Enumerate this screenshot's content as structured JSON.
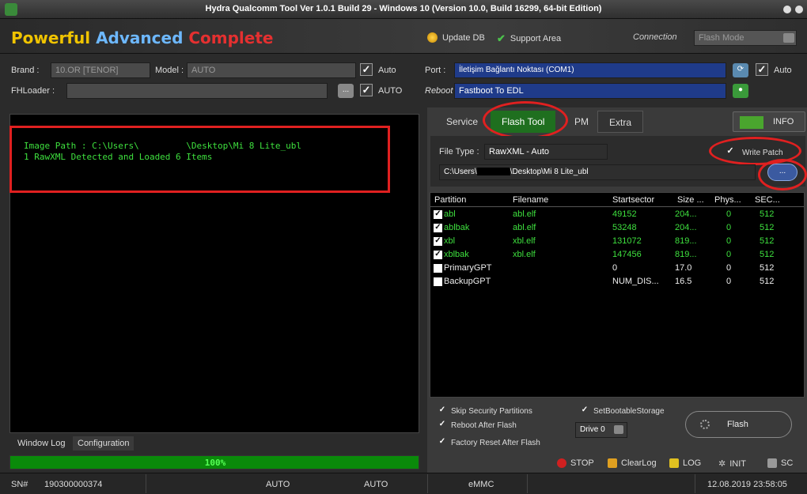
{
  "window": {
    "title": "Hydra Qualcomm Tool Ver 1.0.1 Build 29 -  Windows 10 (Version 10.0, Build 16299, 64-bit Edition)"
  },
  "header": {
    "brand": [
      "Powerful",
      "Advanced",
      "Complete"
    ],
    "update_db": "Update DB",
    "support_area": "Support Area",
    "connection_label": "Connection",
    "connection_mode": "Flash Mode"
  },
  "left_config": {
    "brand_label": "Brand :",
    "brand_value": "10.OR [TENOR]",
    "model_label": "Model :",
    "model_value": "AUTO",
    "auto1": "Auto",
    "fhloader_label": "FHLoader :",
    "fhloader_value": "",
    "fh_btn": "...",
    "auto2": "AUTO"
  },
  "right_config": {
    "port_label": "Port :",
    "port_value": "İletişim Bağlantı Noktası (COM1)",
    "port_auto": "Auto",
    "reboot_label": "Reboot",
    "reboot_value": "Fastboot To EDL"
  },
  "log": {
    "line1": "Image Path : C:\\Users\\         \\Desktop\\Mi 8 Lite_ubl",
    "line2": "1 RawXML Detected and Loaded 6 Items"
  },
  "bottom_tabs": [
    "Window Log",
    "Configuration"
  ],
  "progress": {
    "value": 1.0,
    "label": "100%"
  },
  "tabs": [
    "Service",
    "Flash Tool",
    "PM",
    "Extra"
  ],
  "info_label": "INFO",
  "filetype": {
    "label": "File Type :",
    "value": "RawXML - Auto",
    "write_patch": "Write Patch",
    "path": "C:\\Users\\",
    "path_tail": "\\Desktop\\Mi 8 Lite_ubl",
    "browse": "..."
  },
  "table": {
    "headers": [
      "Partition",
      "Filename",
      "Startsector",
      "Size ...",
      "Phys...",
      "SEC..."
    ],
    "rows": [
      {
        "checked": true,
        "partition": "abl",
        "filename": "abl.elf",
        "start": "49152",
        "size": "204...",
        "phys": "0",
        "sec": "512"
      },
      {
        "checked": true,
        "partition": "ablbak",
        "filename": "abl.elf",
        "start": "53248",
        "size": "204...",
        "phys": "0",
        "sec": "512"
      },
      {
        "checked": true,
        "partition": "xbl",
        "filename": "xbl.elf",
        "start": "131072",
        "size": "819...",
        "phys": "0",
        "sec": "512"
      },
      {
        "checked": true,
        "partition": "xblbak",
        "filename": "xbl.elf",
        "start": "147456",
        "size": "819...",
        "phys": "0",
        "sec": "512"
      },
      {
        "checked": false,
        "partition": "PrimaryGPT",
        "filename": "",
        "start": "0",
        "size": "17.0",
        "phys": "0",
        "sec": "512"
      },
      {
        "checked": false,
        "partition": "BackupGPT",
        "filename": "",
        "start": "NUM_DIS...",
        "size": "16.5",
        "phys": "0",
        "sec": "512"
      }
    ]
  },
  "options": {
    "skip_security": "Skip Security Partitions",
    "reboot_after": "Reboot After Flash",
    "factory_reset": "Factory Reset After Flash",
    "set_bootable": "SetBootableStorage",
    "drive": "Drive 0",
    "flash": "Flash"
  },
  "toolbar": {
    "stop": "STOP",
    "clearlog": "ClearLog",
    "log": "LOG",
    "init": "INIT",
    "sc": "SC"
  },
  "status": {
    "sn_label": "SN#",
    "sn": "190300000374",
    "auto1": "AUTO",
    "auto2": "AUTO",
    "storage": "eMMC",
    "datetime": "12.08.2019 23:58:05"
  },
  "colors": {
    "accent_green": "#1f6f1f",
    "log_green": "#3ee03e",
    "highlight_red": "#e02020",
    "port_blue": "#1f3b8a"
  }
}
